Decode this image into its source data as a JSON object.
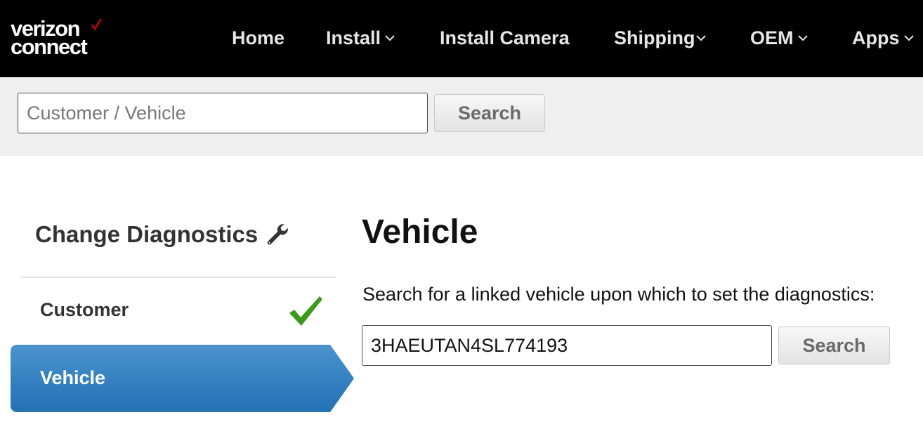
{
  "brand": {
    "line1": "verizon",
    "line2": "connect",
    "accent_color": "#cd040b"
  },
  "nav": {
    "items": [
      {
        "label": "Home",
        "dropdown": false
      },
      {
        "label": "Install",
        "dropdown": true
      },
      {
        "label": "Install Camera",
        "dropdown": false
      },
      {
        "label": "Shipping",
        "dropdown": true
      },
      {
        "label": "OEM",
        "dropdown": true
      },
      {
        "label": "Apps",
        "dropdown": true
      }
    ]
  },
  "search": {
    "placeholder": "Customer / Vehicle",
    "value": "",
    "button_label": "Search"
  },
  "sidebar": {
    "title": "Change Diagnostics",
    "title_icon": "wrench-icon",
    "steps": [
      {
        "label": "Customer",
        "status": "complete",
        "icon": "checkmark-icon"
      },
      {
        "label": "Vehicle",
        "status": "active"
      }
    ]
  },
  "main": {
    "title": "Vehicle",
    "instruction": "Search for a linked vehicle upon which to set the diagnostics:",
    "vehicle_search": {
      "value": "3HAEUTAN4SL774193",
      "button_label": "Search"
    }
  },
  "colors": {
    "topbar": "#000000",
    "search_strip": "#efefef",
    "active_step": "#2f7fc1",
    "check": "#3a9a1a"
  }
}
